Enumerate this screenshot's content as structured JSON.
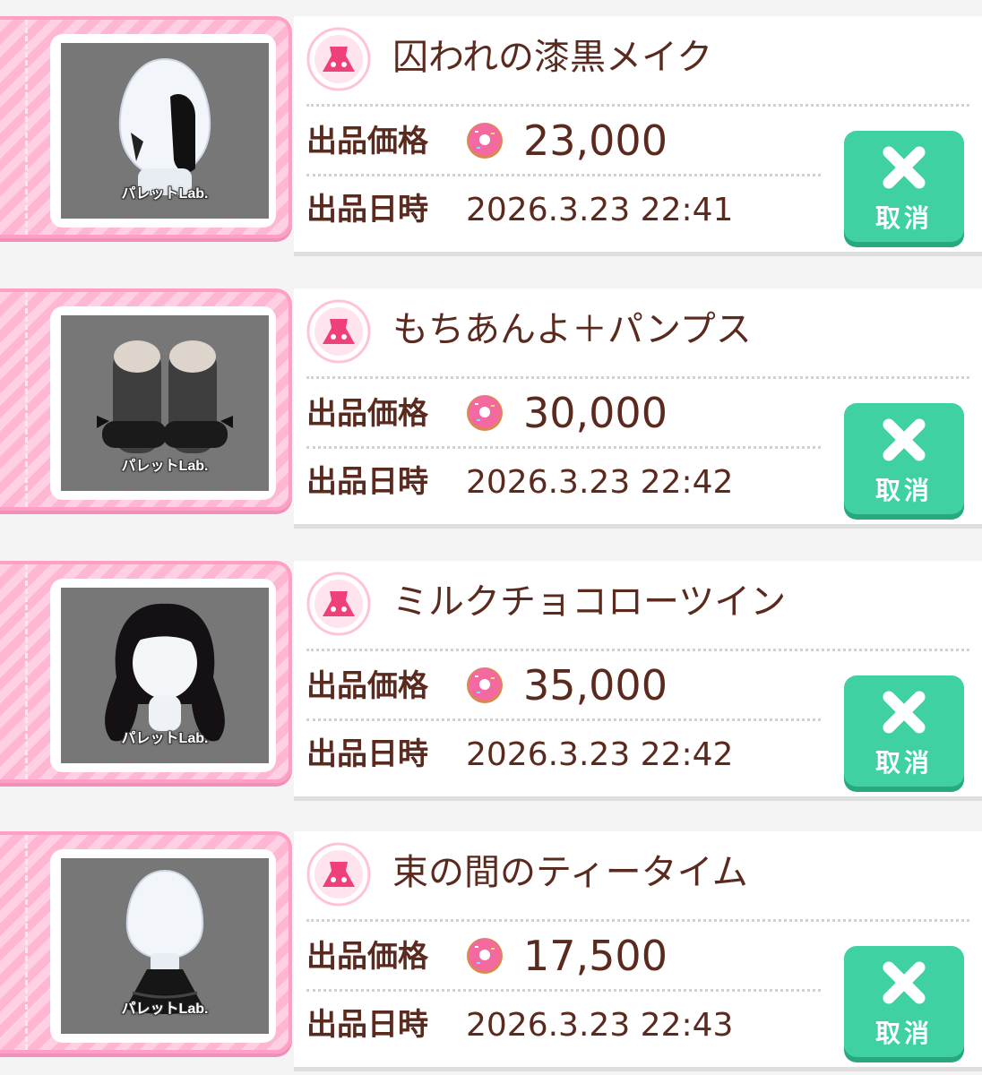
{
  "labels": {
    "price": "出品価格",
    "date": "出品日時",
    "cancel": "取消",
    "brand": "パレットLab."
  },
  "listings": [
    {
      "name": "囚われの漆黒メイク",
      "price": "23,000",
      "date": "2026.3.23 22:41",
      "thumb_icon": "black-hair-makeup-icon"
    },
    {
      "name": "もちあんよ＋パンプス",
      "price": "30,000",
      "date": "2026.3.23 22:42",
      "thumb_icon": "socks-pumps-icon"
    },
    {
      "name": "ミルクチョコローツイン",
      "price": "35,000",
      "date": "2026.3.23 22:42",
      "thumb_icon": "twin-tail-hair-icon"
    },
    {
      "name": "束の間のティータイム",
      "price": "17,500",
      "date": "2026.3.23 22:43",
      "thumb_icon": "black-dress-icon"
    }
  ],
  "colors": {
    "accent_pink": "#ff9fc6",
    "cancel_green": "#3fd1a3",
    "text_brown": "#5a2a1e"
  }
}
